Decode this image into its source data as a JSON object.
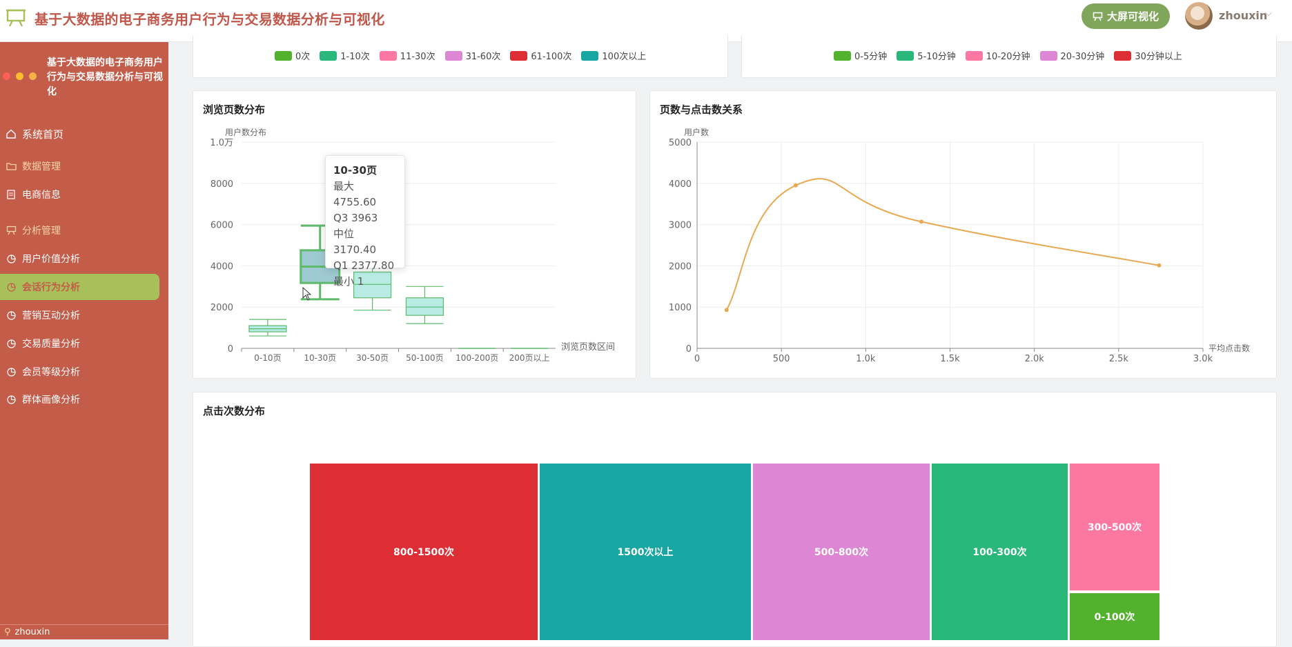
{
  "header": {
    "title": "基于大数据的电子商务用户行为与交易数据分析与可视化",
    "big_screen_label": "大屏可视化",
    "user": "zhouxin"
  },
  "colors": {
    "sidebar": "#c45c4a",
    "active": "#a7c05a",
    "accent": "#7fa65a",
    "line": "#e9a852",
    "box_fill": "#b7ebe3",
    "box_stroke": "#5cba6a"
  },
  "sidebar": {
    "title": "基于大数据的电子商务用户行为与交易数据分析与可视化",
    "home": "系统首页",
    "group_data": "数据管理",
    "item_ecommerce": "电商信息",
    "group_analysis": "分析管理",
    "items": [
      "用户价值分析",
      "会话行为分析",
      "营销互动分析",
      "交易质量分析",
      "会员等级分析",
      "群体画像分析"
    ],
    "footer_user": "zhouxin"
  },
  "legend_left": [
    "0次",
    "1-10次",
    "11-30次",
    "31-60次",
    "61-100次",
    "100次以上"
  ],
  "legend_right": [
    "0-5分钟",
    "5-10分钟",
    "10-20分钟",
    "20-30分钟",
    "30分钟以上"
  ],
  "legend_colors": [
    "#52b22d",
    "#2ab87a",
    "#fd77a3",
    "#dd87d4",
    "#dd2e35",
    "#17a6a2"
  ],
  "box_card": {
    "title": "浏览页数分布",
    "ylabel": "用户数分布",
    "xlabel": "浏览页数区间",
    "yticks": [
      "0",
      "2000",
      "4000",
      "6000",
      "8000",
      "1.0万"
    ]
  },
  "line_card": {
    "title": "页数与点击数关系",
    "ylabel": "用户数",
    "xlabel": "平均点击数",
    "yticks": [
      "0",
      "1000",
      "2000",
      "3000",
      "4000",
      "5000"
    ],
    "xticks": [
      "0",
      "500",
      "1.0k",
      "1.5k",
      "2.0k",
      "2.5k",
      "3.0k"
    ]
  },
  "treemap_card": {
    "title": "点击次数分布"
  },
  "tooltip": {
    "title": "10-30页",
    "max": "最大 4755.60",
    "q3": "Q3 3963",
    "median": "中位 3170.40",
    "q1": "Q1 2377.80",
    "min": "最小 1"
  },
  "chart_data": [
    {
      "type": "box",
      "title": "浏览页数分布",
      "ylabel": "用户数分布",
      "xlabel": "浏览页数区间",
      "ylim": [
        0,
        10000
      ],
      "categories": [
        "0-10页",
        "10-30页",
        "30-50页",
        "50-100页",
        "100-200页",
        "200页以上"
      ],
      "boxes": [
        {
          "min": 600,
          "q1": 800,
          "median": 950,
          "q3": 1100,
          "max": 1400
        },
        {
          "min": 2377.8,
          "q1": 3170,
          "median": 3963,
          "q3": 4755.6,
          "max": 5950
        },
        {
          "min": 1850,
          "q1": 2450,
          "median": 3100,
          "q3": 3700,
          "max": 4300
        },
        {
          "min": 1200,
          "q1": 1600,
          "median": 2000,
          "q3": 2450,
          "max": 3000
        },
        {
          "min": 0,
          "q1": 0,
          "median": 0,
          "q3": 0,
          "max": 0
        },
        {
          "min": 0,
          "q1": 0,
          "median": 0,
          "q3": 0,
          "max": 0
        }
      ]
    },
    {
      "type": "line",
      "title": "页数与点击数关系",
      "ylabel": "用户数",
      "xlabel": "平均点击数",
      "xlim": [
        0,
        3000
      ],
      "ylim": [
        0,
        5000
      ],
      "points": [
        [
          175,
          930
        ],
        [
          585,
          3950
        ],
        [
          1330,
          3070
        ],
        [
          2740,
          2010
        ]
      ]
    },
    {
      "type": "treemap",
      "title": "点击次数分布",
      "cells": [
        {
          "label": "800-1500次",
          "color": "#dd2e35"
        },
        {
          "label": "1500次以上",
          "color": "#17a6a2"
        },
        {
          "label": "500-800次",
          "color": "#dd87d4"
        },
        {
          "label": "100-300次",
          "color": "#2ab87a"
        },
        {
          "label": "300-500次",
          "color": "#fd77a3"
        },
        {
          "label": "0-100次",
          "color": "#52b22d"
        }
      ]
    }
  ]
}
